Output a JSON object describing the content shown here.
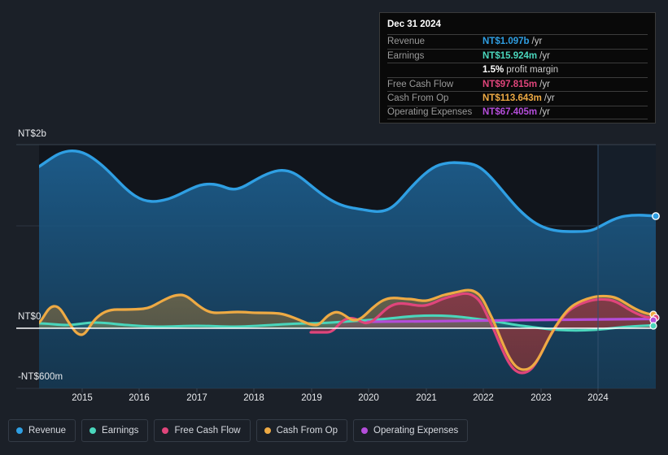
{
  "tooltip": {
    "date": "Dec 31 2024",
    "rows": [
      {
        "label": "Revenue",
        "value": "NT$1.097b",
        "suffix": "/yr",
        "color": "#2f9fe3"
      },
      {
        "label": "Earnings",
        "value": "NT$15.924m",
        "suffix": "/yr",
        "color": "#4ad6bc"
      },
      {
        "label": "",
        "value": "1.5%",
        "suffix": "profit margin",
        "color": "#ffffff"
      },
      {
        "label": "Free Cash Flow",
        "value": "NT$97.815m",
        "suffix": "/yr",
        "color": "#e0457b"
      },
      {
        "label": "Cash From Op",
        "value": "NT$113.643m",
        "suffix": "/yr",
        "color": "#eeaa44"
      },
      {
        "label": "Operating Expenses",
        "value": "NT$67.405m",
        "suffix": "/yr",
        "color": "#b44dda"
      }
    ]
  },
  "legend": [
    {
      "label": "Revenue",
      "color": "#2f9fe3"
    },
    {
      "label": "Earnings",
      "color": "#4ad6bc"
    },
    {
      "label": "Free Cash Flow",
      "color": "#e0457b"
    },
    {
      "label": "Cash From Op",
      "color": "#eeaa44"
    },
    {
      "label": "Operating Expenses",
      "color": "#b44dda"
    }
  ],
  "axis": {
    "y_top": "NT$2b",
    "y_zero": "NT$0",
    "y_bottom": "-NT$600m",
    "x_ticks": [
      "2015",
      "2016",
      "2017",
      "2018",
      "2019",
      "2020",
      "2021",
      "2022",
      "2023",
      "2024"
    ]
  },
  "chart_data": {
    "type": "area",
    "title": "",
    "xlabel": "",
    "ylabel": "NT$",
    "ylim": [
      -600000000,
      2000000000
    ],
    "ytick_labels": [
      "NT$2b",
      "NT$0",
      "-NT$600m"
    ],
    "ytick_values": [
      2000000000,
      0,
      -600000000
    ],
    "x_range": [
      "2014-06",
      "2025-03"
    ],
    "currency": "NT$",
    "grid": true,
    "legend_position": "bottom",
    "series": [
      {
        "name": "Revenue",
        "color": "#2f9fe3",
        "filled": true,
        "x": [
          "2014.5",
          "2014.9",
          "2015.3",
          "2015.7",
          "2016.1",
          "2016.5",
          "2016.9",
          "2017.3",
          "2017.7",
          "2018.1",
          "2018.5",
          "2018.9",
          "2019.3",
          "2019.7",
          "2020.1",
          "2020.5",
          "2020.9",
          "2021.3",
          "2021.7",
          "2022.1",
          "2022.5",
          "2022.9",
          "2023.3",
          "2023.7",
          "2024.1",
          "2024.5",
          "2024.9",
          "2025.0"
        ],
        "values": [
          1.8,
          1.94,
          1.92,
          1.76,
          1.58,
          1.5,
          1.52,
          1.57,
          1.62,
          1.58,
          1.47,
          1.37,
          1.31,
          1.28,
          1.22,
          1.28,
          1.42,
          1.57,
          1.56,
          1.45,
          1.25,
          1.1,
          0.99,
          0.98,
          0.98,
          1.05,
          1.09,
          1.097
        ],
        "units": "NT$ billions"
      },
      {
        "name": "Earnings",
        "color": "#4ad6bc",
        "filled": true,
        "x": [
          "2014.5",
          "2014.9",
          "2015.3",
          "2015.7",
          "2016.1",
          "2016.5",
          "2016.9",
          "2017.3",
          "2017.7",
          "2018.1",
          "2018.5",
          "2018.9",
          "2019.3",
          "2019.7",
          "2020.1",
          "2020.5",
          "2020.9",
          "2021.3",
          "2021.7",
          "2022.1",
          "2022.5",
          "2022.9",
          "2023.3",
          "2023.7",
          "2024.1",
          "2024.5",
          "2024.9",
          "2025.0"
        ],
        "values": [
          38,
          34,
          26,
          40,
          44,
          42,
          38,
          34,
          30,
          26,
          24,
          22,
          24,
          30,
          36,
          44,
          52,
          56,
          54,
          46,
          30,
          12,
          -6,
          -18,
          -22,
          -12,
          6,
          15.924
        ],
        "units": "NT$ millions"
      },
      {
        "name": "Free Cash Flow",
        "color": "#e0457b",
        "filled": true,
        "starts_at": "2019.1",
        "x": [
          "2019.1",
          "2019.5",
          "2019.9",
          "2020.3",
          "2020.7",
          "2021.1",
          "2021.5",
          "2021.9",
          "2022.1",
          "2022.4",
          "2022.7",
          "2023.0",
          "2023.3",
          "2023.6",
          "2023.9",
          "2024.2",
          "2024.5",
          "2024.8",
          "2025.0"
        ],
        "values": [
          -22,
          -20,
          10,
          86,
          104,
          120,
          132,
          170,
          140,
          20,
          -310,
          -450,
          -470,
          -330,
          -60,
          100,
          150,
          120,
          97.815
        ],
        "units": "NT$ millions"
      },
      {
        "name": "Cash From Op",
        "color": "#eeaa44",
        "filled": true,
        "x": [
          "2014.5",
          "2014.8",
          "2015.1",
          "2015.4",
          "2015.8",
          "2016.2",
          "2016.6",
          "2017.0",
          "2017.4",
          "2017.8",
          "2018.2",
          "2018.6",
          "2019.0",
          "2019.3",
          "2019.7",
          "2020.1",
          "2020.5",
          "2020.9",
          "2021.3",
          "2021.7",
          "2022.0",
          "2022.3",
          "2022.6",
          "2022.9",
          "2023.2",
          "2023.5",
          "2023.9",
          "2024.2",
          "2024.6",
          "2024.9",
          "2025.0"
        ],
        "values": [
          30,
          84,
          -18,
          48,
          52,
          110,
          78,
          60,
          66,
          62,
          50,
          20,
          -4,
          46,
          20,
          90,
          124,
          136,
          130,
          178,
          150,
          30,
          -290,
          -430,
          -455,
          -320,
          -40,
          110,
          160,
          128,
          113.643
        ],
        "units": "NT$ millions"
      },
      {
        "name": "Operating Expenses",
        "color": "#b44dda",
        "filled": false,
        "starts_at": "2020.2",
        "x": [
          "2020.2",
          "2021.0",
          "2022.0",
          "2023.0",
          "2024.0",
          "2025.0"
        ],
        "values": [
          52,
          56,
          60,
          62,
          65,
          67.405
        ],
        "units": "NT$ millions"
      }
    ]
  }
}
